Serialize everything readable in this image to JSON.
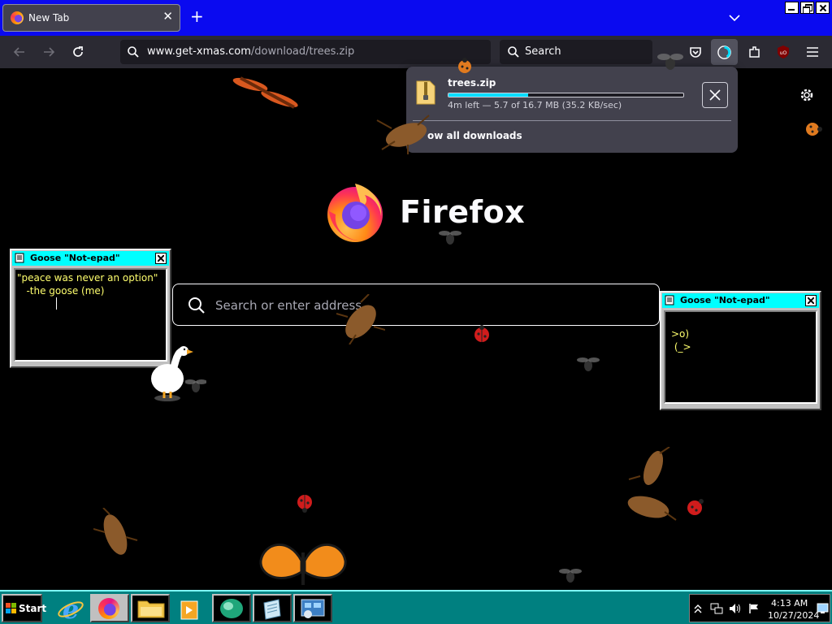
{
  "browser": {
    "tab": {
      "title": "New Tab"
    },
    "url": {
      "host": "www.get-xmas.com",
      "path": "/download/trees.zip"
    },
    "search_label": "Search"
  },
  "downloads": {
    "file_name": "trees.zip",
    "progress_fraction": 0.34,
    "status": "4m left — 5.7 of 16.7 MB (35.2 KB/sec)",
    "show_all": "ow all downloads"
  },
  "newtab": {
    "wordmark": "Firefox",
    "search_placeholder": "Search or enter address"
  },
  "notepads": [
    {
      "title": "Goose \"Not-epad\"",
      "text": "\"peace was never an option\"\n   -the goose (me)"
    },
    {
      "title": "Goose \"Not-epad\"",
      "text": ">o)\n (_>"
    }
  ],
  "taskbar": {
    "start_label": "Start",
    "time": "4:13 AM",
    "date": "10/27/2024"
  },
  "colors": {
    "titlebar": "#0a0af0",
    "toolbar": "#2b2a33",
    "accent": "#00ddff",
    "notepad_title": "#00ffff",
    "notepad_text": "#ffff6e",
    "taskbar": "#008080"
  },
  "icons": [
    "firefox-icon",
    "tab-close-icon",
    "new-tab-icon",
    "list-all-tabs-icon",
    "back-icon",
    "forward-icon",
    "reload-icon",
    "search-icon",
    "pocket-icon",
    "downloads-icon",
    "extensions-icon",
    "ublock-icon",
    "menu-icon",
    "zip-file-icon",
    "cancel-download-icon",
    "settings-gear-icon"
  ]
}
